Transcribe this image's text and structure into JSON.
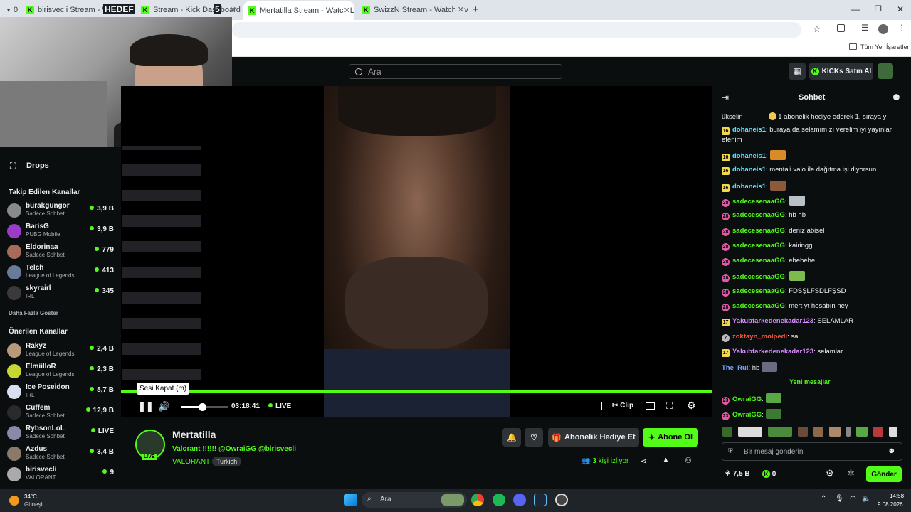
{
  "browser": {
    "tabs": [
      {
        "label": "0",
        "kind": "counter"
      },
      {
        "label": "birisvecli Stream - Watch L",
        "overlay": "HEDEF"
      },
      {
        "label": "Stream - Kick Dashboard",
        "overlay": "5"
      },
      {
        "label": "Mertatilla Stream - Watch Live",
        "active": true
      },
      {
        "label": "SwizzN Stream - Watch Live on"
      }
    ],
    "new_tab": "+",
    "bookmarks_label": "Tüm Yer İşaretleri"
  },
  "header": {
    "search_placeholder": "Ara",
    "buy_kicks": "KICKs Satın Al"
  },
  "sidebar": {
    "drops": "Drops",
    "followed_title": "Takip Edilen Kanallar",
    "followed": [
      {
        "name": "burakgungor",
        "category": "Sadece Sohbet",
        "viewers": "3,9 B"
      },
      {
        "name": "BarisG",
        "category": "PUBG Mobile",
        "viewers": "3,9 B"
      },
      {
        "name": "Eldorinaa",
        "category": "Sadece Sohbet",
        "viewers": "779"
      },
      {
        "name": "Telch",
        "category": "League of Legends",
        "viewers": "413"
      },
      {
        "name": "skyrairl",
        "category": "IRL",
        "viewers": "345"
      }
    ],
    "show_more": "Daha Fazla Göster",
    "recommended_title": "Önerilen Kanallar",
    "recommended": [
      {
        "name": "Rakyz",
        "category": "League of Legends",
        "viewers": "2,4 B"
      },
      {
        "name": "ElmiilloR",
        "category": "League of Legends",
        "viewers": "2,3 B"
      },
      {
        "name": "Ice Poseidon",
        "category": "IRL",
        "viewers": "8,7 B"
      },
      {
        "name": "Cuffem",
        "category": "Sadece Sohbet",
        "viewers": "12,9 B"
      },
      {
        "name": "RybsonLoL",
        "category": "Sadece Sohbet",
        "viewers": "LIVE"
      },
      {
        "name": "Azdus",
        "category": "Sadece Sohbet",
        "viewers": "3,4 B"
      },
      {
        "name": "birisvecli",
        "category": "VALORANT",
        "viewers": "9"
      }
    ]
  },
  "player": {
    "tooltip": "Sesi Kapat (m)",
    "time": "03:18:41",
    "live": "LIVE",
    "clip": "Clip",
    "volume_fraction": 0.45
  },
  "stream": {
    "streamer": "Mertatilla",
    "title": "Valorant !!!!!! @OwraiGG @birisvecli",
    "category": "VALORANT",
    "tag": "Turkish",
    "live_badge": "LIVE",
    "gift_sub": "Abonelik Hediye Et",
    "subscribe": "Abone Ol",
    "viewers_count": "3",
    "viewers_label": "kişi izliyor"
  },
  "chat": {
    "title": "Sohbet",
    "pinned_user": "ükselin",
    "pinned_text": "1 abonelik hediye ederek 1. sıraya y",
    "messages": [
      {
        "badge": "16",
        "cls": "b16",
        "user": "dohaneis1",
        "color": "#59e3ff",
        "text": ": buraya da selamımızı verelim iyi yayınlar",
        "text2": "efenim"
      },
      {
        "badge": "16",
        "cls": "b16",
        "user": "dohaneis1",
        "color": "#59e3ff",
        "text": ":",
        "emote": "#d98b2a"
      },
      {
        "badge": "16",
        "cls": "b16",
        "user": "dohaneis1",
        "color": "#59e3ff",
        "text": ": mentali valo ile dağıtma işi diyorsun"
      },
      {
        "badge": "16",
        "cls": "b16",
        "user": "dohaneis1",
        "color": "#59e3ff",
        "text": ":",
        "emote": "#8a5a3a"
      },
      {
        "badge": "28",
        "cls": "b28",
        "user": "sadecesenaaGG",
        "color": "#53fc18",
        "text": ":",
        "emote": "#b8c0c8"
      },
      {
        "badge": "28",
        "cls": "b28",
        "user": "sadecesenaaGG",
        "color": "#53fc18",
        "text": ": hb hb"
      },
      {
        "badge": "28",
        "cls": "b28",
        "user": "sadecesenaaGG",
        "color": "#53fc18",
        "text": ": deniz abisel"
      },
      {
        "badge": "28",
        "cls": "b28",
        "user": "sadecesenaaGG",
        "color": "#53fc18",
        "text": ": kairingg"
      },
      {
        "badge": "28",
        "cls": "b28",
        "user": "sadecesenaaGG",
        "color": "#53fc18",
        "text": ": ehehehe"
      },
      {
        "badge": "28",
        "cls": "b28",
        "user": "sadecesenaaGG",
        "color": "#53fc18",
        "text": ":",
        "emote": "#7dbb4f"
      },
      {
        "badge": "28",
        "cls": "b28",
        "user": "sadecesenaaGG",
        "color": "#53fc18",
        "text": ": FDSŞLFSDLFŞSD"
      },
      {
        "badge": "28",
        "cls": "b28",
        "user": "sadecesenaaGG",
        "color": "#53fc18",
        "text": ": mert yt hesabın ney"
      },
      {
        "badge": "17",
        "cls": "b17",
        "user": "Yakubfarkedenekadar123",
        "color": "#d88cff",
        "text": ": SELAMLAR"
      },
      {
        "badge": "7",
        "cls": "b7",
        "user": "zoktayn_molpedi",
        "color": "#ff5a3c",
        "text": ": sa"
      },
      {
        "badge": "17",
        "cls": "b17",
        "user": "Yakubfarkedenekadar123",
        "color": "#d88cff",
        "text": ": selamlar"
      },
      {
        "badge": "",
        "cls": "",
        "user": "The_Rui",
        "color": "#7aa7ff",
        "text": ": hb",
        "emote": "#6a6a80"
      }
    ],
    "new_messages": "Yeni mesajlar",
    "after": [
      {
        "badge": "23",
        "cls": "b23",
        "user": "OwraiGG",
        "color": "#53fc18",
        "text": ":",
        "emote": "#5aa845"
      },
      {
        "badge": "23",
        "cls": "b23",
        "user": "OwraiGG",
        "color": "#53fc18",
        "text": ":",
        "emote": "#3c7a34"
      }
    ],
    "input_placeholder": "Bir mesaj gönderin",
    "kicks_amount": "7,5 B",
    "points": "0",
    "send": "Gönder"
  },
  "taskbar": {
    "temp": "34°C",
    "weather": "Güneşli",
    "search": "Ara",
    "time": "14:58",
    "date": "9.08.2026"
  },
  "colors": {
    "accent": "#53fc18",
    "bg": "#0b0e0f"
  }
}
